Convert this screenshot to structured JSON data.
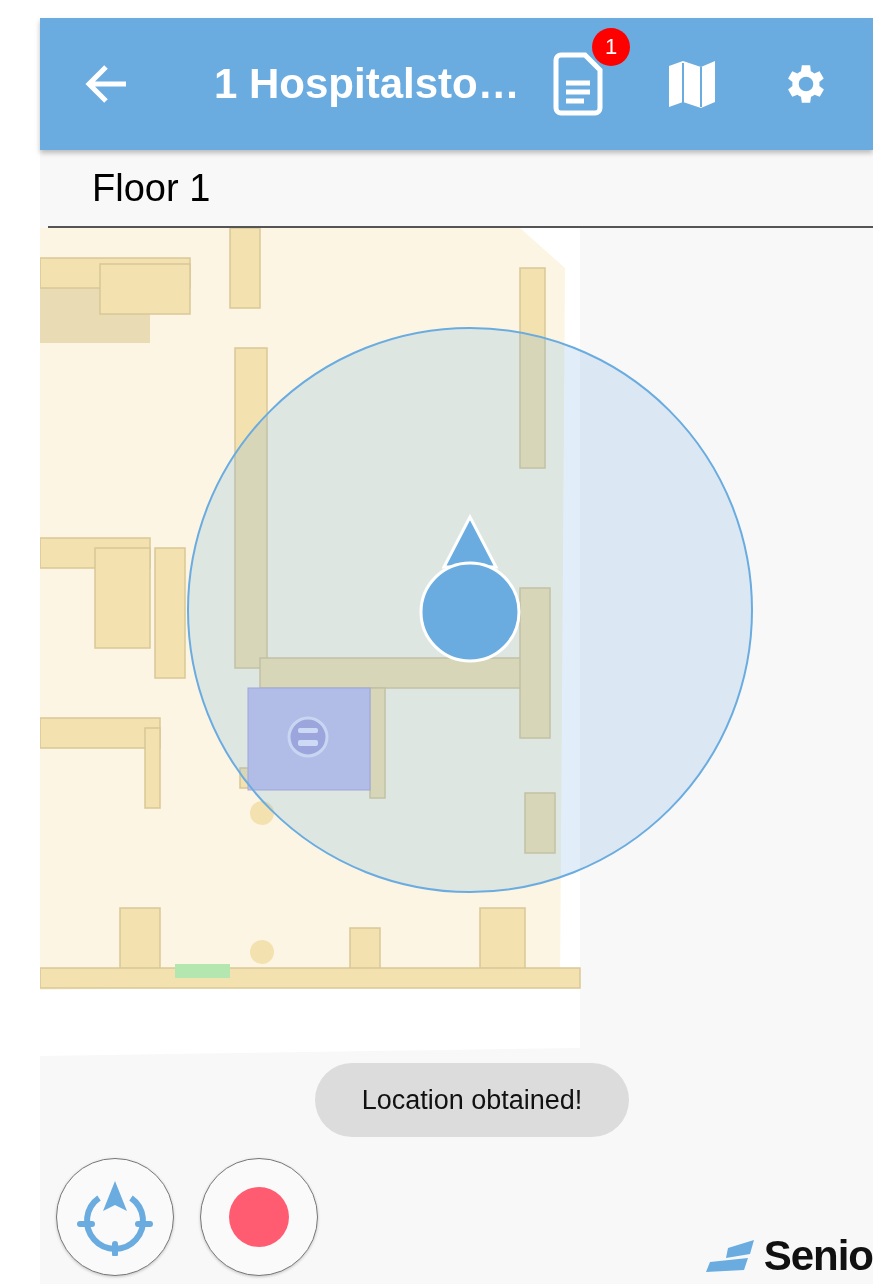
{
  "app_bar": {
    "title": "1 Hospitalsto…",
    "notification_count": "1"
  },
  "floor_bar": {
    "label": "Floor 1"
  },
  "toast": {
    "message": "Location obtained!"
  },
  "logo": {
    "text": "Senio"
  }
}
